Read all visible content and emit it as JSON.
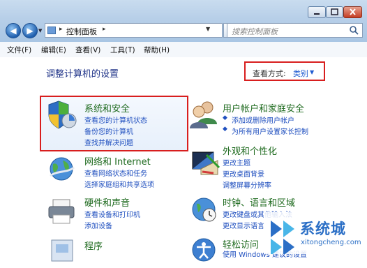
{
  "address": {
    "label": "控制面板",
    "separator": "▸"
  },
  "search": {
    "placeholder": "搜索控制面板"
  },
  "menu": [
    "文件(F)",
    "编辑(E)",
    "查看(V)",
    "工具(T)",
    "帮助(H)"
  ],
  "page": {
    "heading": "调整计算机的设置"
  },
  "view_by": {
    "label": "查看方式:",
    "value": "类别"
  },
  "categories": {
    "system_security": {
      "title": "系统和安全",
      "links": [
        "查看您的计算机状态",
        "备份您的计算机",
        "查找并解决问题"
      ]
    },
    "user_accounts": {
      "title": "用户帐户和家庭安全",
      "links": [
        "添加或删除用户帐户",
        "为所有用户设置家长控制"
      ]
    },
    "network": {
      "title": "网络和 Internet",
      "links": [
        "查看网络状态和任务",
        "选择家庭组和共享选项"
      ]
    },
    "appearance": {
      "title": "外观和个性化",
      "links": [
        "更改主题",
        "更改桌面背景",
        "调整屏幕分辨率"
      ]
    },
    "hardware": {
      "title": "硬件和声音",
      "links": [
        "查看设备和打印机",
        "添加设备"
      ]
    },
    "clock": {
      "title": "时钟、语言和区域",
      "links": [
        "更改键盘或其他输入法",
        "更改显示语言"
      ]
    },
    "programs": {
      "title": "程序"
    },
    "ease": {
      "title": "轻松访问",
      "links": [
        "使用 Windows 建议的设置"
      ]
    }
  },
  "watermark": {
    "text": "系统城",
    "url": "xitongcheng.com"
  },
  "colors": {
    "highlight_red": "#d81e1e",
    "link_blue": "#1f4fbf",
    "title_green": "#1e6a1e",
    "heading_blue": "#1e3287"
  }
}
